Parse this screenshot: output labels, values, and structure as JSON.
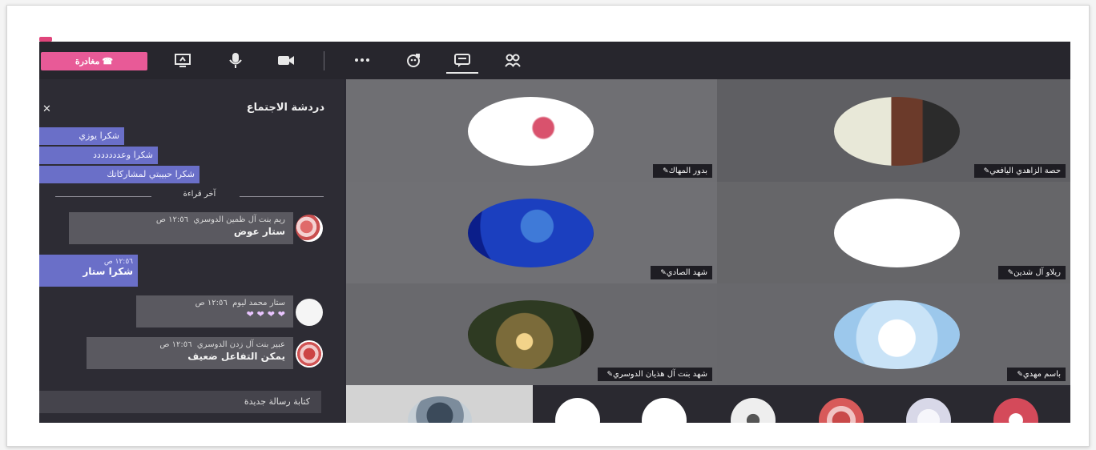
{
  "toolbar": {
    "leave_label": "مغادرة",
    "icons": [
      "share-screen-icon",
      "mic-icon",
      "camera-icon",
      "more-icon",
      "reactions-icon",
      "chat-icon",
      "participants-icon"
    ]
  },
  "chat": {
    "title": "دردشة الاجتماع",
    "sent_pills": [
      "شكرا يوزي",
      "شكرا وعددددددد",
      "شكرا حبيبتي لمشاركاتك"
    ],
    "last_read_label": "آخر قراءة",
    "messages": [
      {
        "sender": "ريم بنت آل ظمين الدوسري",
        "time": "١٢:٥٦ ص",
        "text": "ستار عوض"
      },
      {
        "sender": "ستار محمد ليوم",
        "time": "١٢:٥٦ ص",
        "text": "❤ ❤ ❤ ❤"
      },
      {
        "sender": "عبير بنت آل زدن الدوسري",
        "time": "١٢:٥٦ ص",
        "text": "يمكن التفاعل ضعيف"
      }
    ],
    "self_message": {
      "time": "١٢:٥٦ ص",
      "text": "شكرا ستار"
    },
    "compose_placeholder": "كتابة رسالة جديدة"
  },
  "participants": [
    {
      "name": "حصة الزاهدي اليافعي",
      "muted": true
    },
    {
      "name": "بدور المهاك",
      "muted": true
    },
    {
      "name": "ريلاو آل شدين",
      "muted": true
    },
    {
      "name": "شهد الصادي",
      "muted": true
    },
    {
      "name": "باسم مهدي",
      "muted": true
    },
    {
      "name": "شهد بنت آل هذيان الدوسري",
      "muted": true
    }
  ],
  "colors": {
    "accent": "#e85a97",
    "chat_bubble_self": "#6a6fc8",
    "tile_bg": "#6b6b6f",
    "app_bg": "#2b2a33"
  }
}
